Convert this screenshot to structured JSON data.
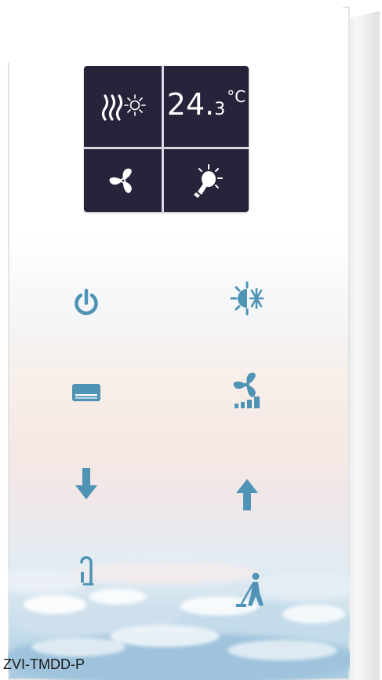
{
  "device": {
    "model_caption": "ZVI-TMDD-P"
  },
  "display": {
    "temperature_integer": "24.",
    "temperature_decimal": "3",
    "temperature_unit": "°C",
    "icons": {
      "top_left": "heating-sun-icon",
      "top_right": "temperature-readout",
      "bottom_left": "fan-icon",
      "bottom_right": "light-bulb-icon"
    }
  },
  "buttons": {
    "left": [
      "power-icon",
      "ac-unit-icon",
      "arrow-down-icon",
      "door-handle-icon"
    ],
    "right": [
      "heat-cool-mode-icon",
      "fan-speed-icon",
      "arrow-up-icon",
      "cleaning-service-icon"
    ]
  },
  "colors": {
    "icon_accent": "#4f93b5",
    "display_bg": "#26233a",
    "display_fg": "#ffffff"
  }
}
